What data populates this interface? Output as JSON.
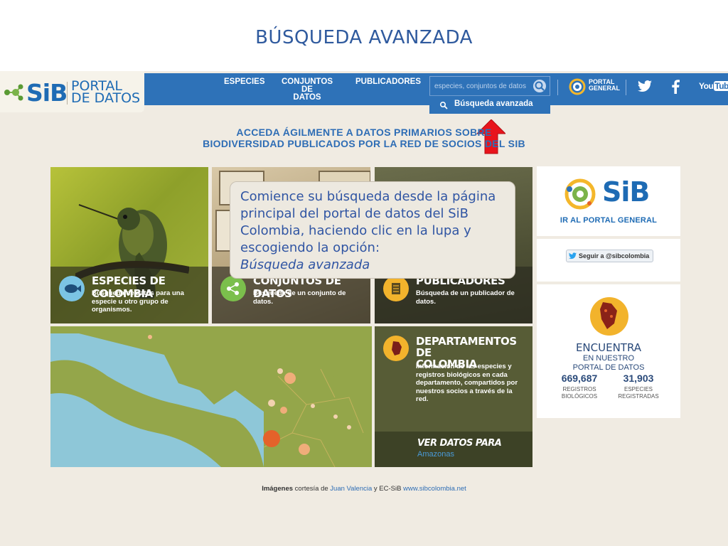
{
  "slide_title": "BÚSQUEDA AVANZADA",
  "logo": {
    "sib": "SiB",
    "portal_line1": "PORTAL",
    "portal_line2": "DE DATOS"
  },
  "nav": {
    "especies": "ESPECIES",
    "conjuntos_line1": "CONJUNTOS DE",
    "conjuntos_line2": "DATOS",
    "publicadores": "PUBLICADORES",
    "search_placeholder": "especies, conjuntos de datos",
    "advanced_search": "Búsqueda avanzada",
    "portal_general_line1": "PORTAL",
    "portal_general_line2": "GENERAL",
    "youtube": "YouTube"
  },
  "headline_line1": "ACCEDA ÁGILMENTE A DATOS PRIMARIOS SOBRE",
  "headline_line2": "BIODIVERSIDAD PUBLICADOS POR LA RED DE SOCIOS DEL SIB",
  "tiles": {
    "especies": {
      "title": "ESPECIES DE COLOMBIA",
      "desc": "Búsqueda de datos para una especie u otro grupo de organismos."
    },
    "conjuntos": {
      "title": "CONJUNTOS DE DATOS",
      "desc": "Búsqueda de un conjunto de datos."
    },
    "publicadores": {
      "title": "PUBLICADORES",
      "desc": "Búsqueda de un publicador de datos."
    },
    "departamentos": {
      "title_line1": "DEPARTAMENTOS DE",
      "title_line2": "COLOMBIA",
      "desc": "Información de las especies y registros biológicos en cada departamento, compartidos por nuestros socios a través de la red.",
      "ver_datos": "VER DATOS PARA",
      "region": "Amazonas"
    }
  },
  "sidebar": {
    "sib": "SiB",
    "ir_portal": "IR AL PORTAL GENERAL",
    "twitter_follow": "Seguir a @sibcolombia",
    "encuentra": "ENCUENTRA",
    "en_nuestro": "EN NUESTRO",
    "portal_datos": "PORTAL DE DATOS",
    "registros_count": "669,687",
    "registros_label_1": "REGISTROS",
    "registros_label_2": "BIOLÓGICOS",
    "especies_count": "31,903",
    "especies_label_1": "ESPECIES",
    "especies_label_2": "REGISTRADAS"
  },
  "callout": {
    "text": "Comience su búsqueda desde la página principal del portal de datos del SiB Colombia, haciendo clic en la lupa y escogiendo la opción:",
    "emphasis": "Búsqueda avanzada"
  },
  "footer": {
    "bold": "Imágenes",
    "text1": " cortesía de ",
    "link1": "Juan Valencia",
    "text2": " y EC-SiB ",
    "link2": "www.sibcolombia.net"
  },
  "colors": {
    "brand_blue": "#2e72b8",
    "arrow_red": "#e8141c",
    "text_blue": "#2f5a9e"
  }
}
